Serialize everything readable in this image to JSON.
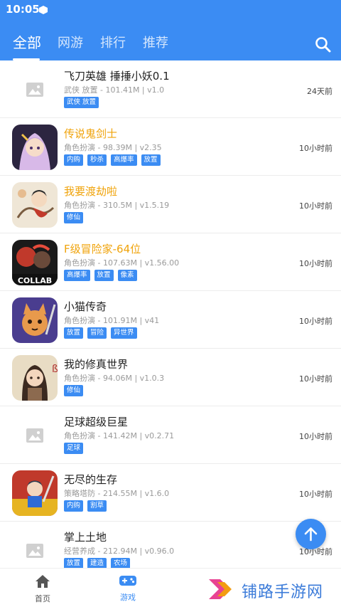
{
  "status": {
    "time": "10:05"
  },
  "tabs": [
    {
      "label": "全部",
      "active": true
    },
    {
      "label": "网游"
    },
    {
      "label": "排行"
    },
    {
      "label": "推荐"
    }
  ],
  "games": [
    {
      "name": "飞刀英雄 捶捶小妖0.1",
      "meta": "武侠 放置 - 101.41M | v1.0",
      "tags": [
        "武侠 放置"
      ],
      "time": "24天前",
      "highlight": false,
      "icon": "placeholder-image-icon"
    },
    {
      "name": "传说鬼剑士",
      "meta": "角色扮演 - 98.39M | v2.35",
      "tags": [
        "内购",
        "秒杀",
        "高爆率",
        "放置"
      ],
      "time": "10小时前",
      "highlight": true,
      "icon": "swordswoman-game-icon"
    },
    {
      "name": "我要渡劫啦",
      "meta": "角色扮演 - 310.5M | v1.5.19",
      "tags": [
        "修仙"
      ],
      "time": "10小时前",
      "highlight": true,
      "icon": "immortal-game-icon"
    },
    {
      "name": "F级冒险家-64位",
      "meta": "角色扮演 - 107.63M | v1.56.00",
      "tags": [
        "高爆率",
        "放置",
        "像素"
      ],
      "time": "10小时前",
      "highlight": true,
      "icon": "collab-game-icon",
      "icon_caption": "COLLAB"
    },
    {
      "name": "小猫传奇",
      "meta": "角色扮演 - 101.91M | v41",
      "tags": [
        "放置",
        "冒险",
        "异世界"
      ],
      "time": "10小时前",
      "highlight": false,
      "icon": "cat-knight-game-icon"
    },
    {
      "name": "我的修真世界",
      "meta": "角色扮演 - 94.06M | v1.0.3",
      "tags": [
        "修仙"
      ],
      "time": "10小时前",
      "highlight": false,
      "icon": "cultivator-game-icon"
    },
    {
      "name": "足球超级巨星",
      "meta": "角色扮演 - 141.42M | v0.2.71",
      "tags": [
        "足球"
      ],
      "time": "10小时前",
      "highlight": false,
      "icon": "placeholder-image-icon"
    },
    {
      "name": "无尽的生存",
      "meta": "策略塔防 - 214.55M | v1.6.0",
      "tags": [
        "内购",
        "割草"
      ],
      "time": "10小时前",
      "highlight": false,
      "icon": "survivor-game-icon"
    },
    {
      "name": "掌上土地",
      "meta": "经营养成 - 212.94M | v0.96.0",
      "tags": [
        "放置",
        "建造",
        "农场"
      ],
      "time": "10小时前",
      "highlight": false,
      "icon": "placeholder-image-icon"
    }
  ],
  "nav": [
    {
      "label": "首页",
      "icon": "home-icon",
      "active": false
    },
    {
      "label": "游戏",
      "icon": "gamepad-icon",
      "active": true
    }
  ],
  "watermark": {
    "text": "铺路手游网"
  },
  "colors": {
    "primary": "#3b8cf3",
    "highlight": "#f0a30a"
  }
}
